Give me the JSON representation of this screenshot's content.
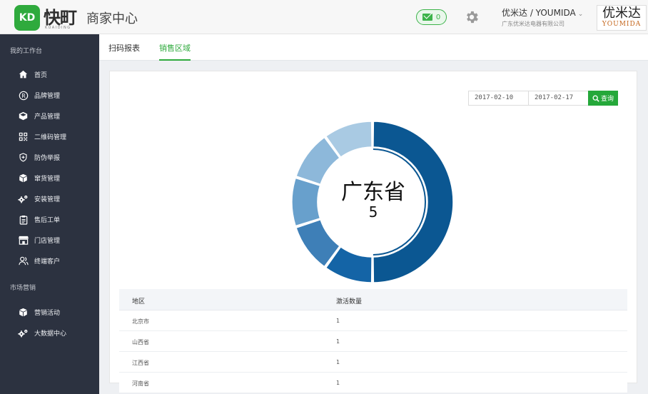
{
  "header": {
    "logo_mark": "KD",
    "logo_word": "快町",
    "logo_sub": "KUAIDING",
    "app_title": "商家中心",
    "mail_count": "0",
    "user_name": "优米达 / YOUMIDA",
    "user_company": "广东优米达电器有限公司",
    "brand_cn": "优米达",
    "brand_en": "YOUMIDA"
  },
  "sidebar": {
    "section_workbench": "我的工作台",
    "section_marketing": "市场营销",
    "items": [
      {
        "label": "首页",
        "icon": "home-icon"
      },
      {
        "label": "品牌管理",
        "icon": "registered-icon"
      },
      {
        "label": "产品管理",
        "icon": "box-icon"
      },
      {
        "label": "二维码管理",
        "icon": "qrcode-icon"
      },
      {
        "label": "防伪举报",
        "icon": "shield-icon"
      },
      {
        "label": "窜货管理",
        "icon": "cube-icon"
      },
      {
        "label": "安装管理",
        "icon": "gears-icon"
      },
      {
        "label": "售后工单",
        "icon": "clipboard-icon"
      },
      {
        "label": "门店管理",
        "icon": "store-icon"
      },
      {
        "label": "终端客户",
        "icon": "users-icon"
      }
    ],
    "marketing_items": [
      {
        "label": "营销活动",
        "icon": "cube-icon"
      },
      {
        "label": "大数据中心",
        "icon": "gears-icon"
      }
    ]
  },
  "tabs": [
    {
      "label": "扫码报表",
      "active": false
    },
    {
      "label": "销售区域",
      "active": true
    }
  ],
  "filter": {
    "start_date": "2017-02-10",
    "end_date": "2017-02-17",
    "query_label": "查询"
  },
  "chart_data": {
    "type": "pie",
    "hole": true,
    "center_label": "广东省",
    "center_value": "5",
    "segments": [
      {
        "name": "广东省",
        "value": 5,
        "color": "#0b5792"
      },
      {
        "name": "",
        "value": 1,
        "color": "#1464a6"
      },
      {
        "name": "",
        "value": 1,
        "color": "#3e7fb7"
      },
      {
        "name": "",
        "value": 1,
        "color": "#68a0cc"
      },
      {
        "name": "",
        "value": 1,
        "color": "#8db8da"
      },
      {
        "name": "",
        "value": 1,
        "color": "#a9cae3"
      }
    ]
  },
  "table": {
    "headers": [
      "地区",
      "激活数量"
    ],
    "rows": [
      [
        "北京市",
        "1"
      ],
      [
        "山西省",
        "1"
      ],
      [
        "江西省",
        "1"
      ],
      [
        "河南省",
        "1"
      ]
    ]
  },
  "colors": {
    "accent": "#2faa3d",
    "sidebar_bg": "#2c3240"
  }
}
